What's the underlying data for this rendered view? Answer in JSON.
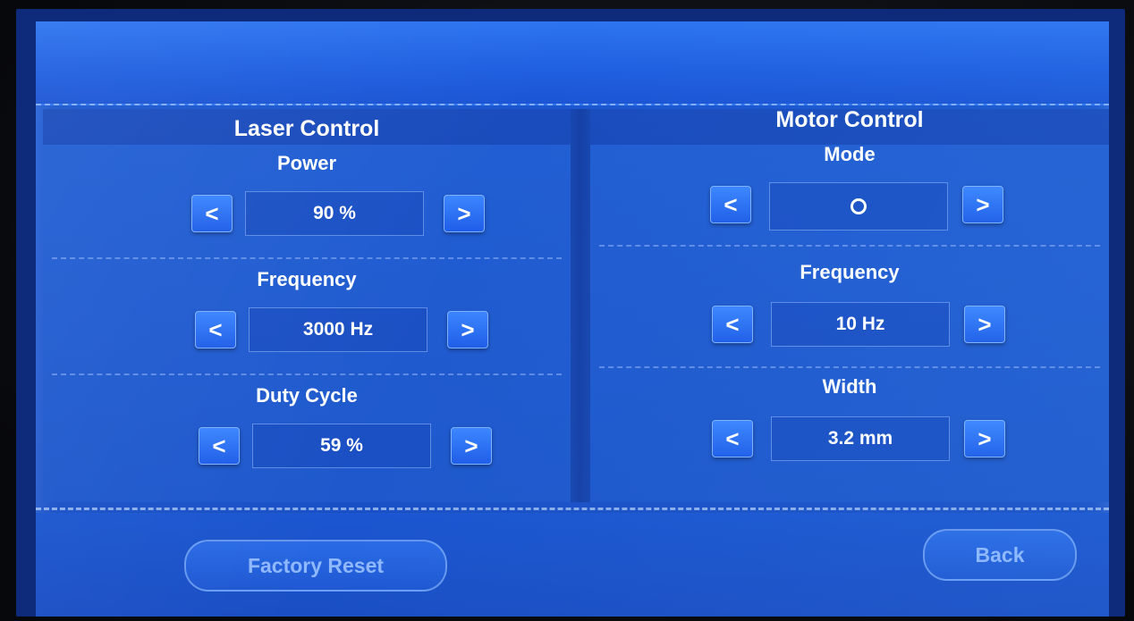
{
  "laser": {
    "title": "Laser Control",
    "power": {
      "label": "Power",
      "value": "90 %",
      "decrement": "<",
      "increment": ">"
    },
    "frequency": {
      "label": "Frequency",
      "value": "3000 Hz",
      "decrement": "<",
      "increment": ">"
    },
    "duty_cycle": {
      "label": "Duty Cycle",
      "value": "59 %",
      "decrement": "<",
      "increment": ">"
    }
  },
  "motor": {
    "title": "Motor Control",
    "mode": {
      "label": "Mode",
      "value_icon": "circle-icon",
      "decrement": "<",
      "increment": ">"
    },
    "frequency": {
      "label": "Frequency",
      "value": "10 Hz",
      "decrement": "<",
      "increment": ">"
    },
    "width": {
      "label": "Width",
      "value": "3.2 mm",
      "decrement": "<",
      "increment": ">"
    }
  },
  "footer": {
    "factory_reset_label": "Factory Reset",
    "back_label": "Back"
  },
  "colors": {
    "screen_blue": "#1a56d0",
    "button_blue": "#2f74f4",
    "text_white": "#ffffff",
    "muted_button_text": "#8fb8ff"
  }
}
